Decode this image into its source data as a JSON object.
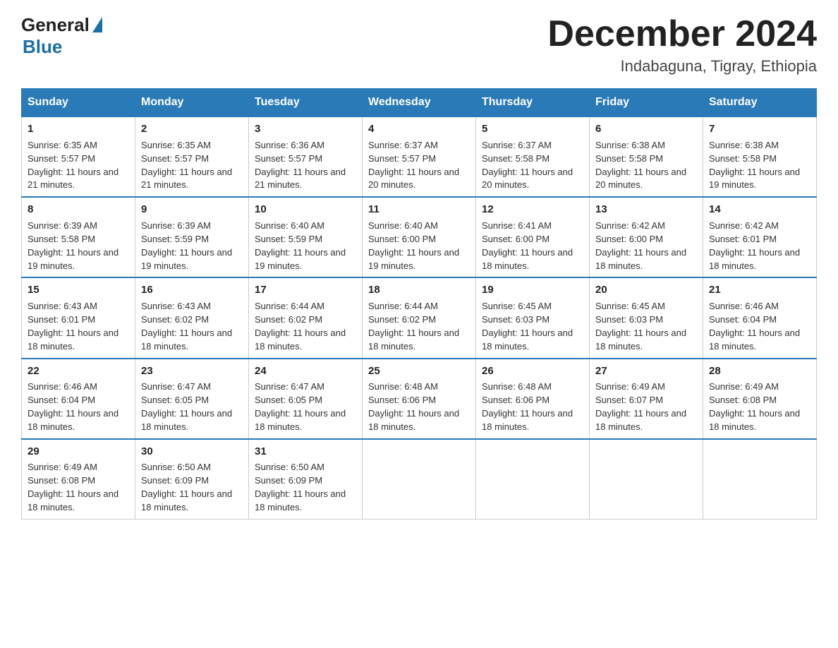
{
  "header": {
    "logo_general": "General",
    "logo_blue": "Blue",
    "month_title": "December 2024",
    "location": "Indabaguna, Tigray, Ethiopia"
  },
  "days_of_week": [
    "Sunday",
    "Monday",
    "Tuesday",
    "Wednesday",
    "Thursday",
    "Friday",
    "Saturday"
  ],
  "weeks": [
    [
      {
        "day": "1",
        "sunrise": "6:35 AM",
        "sunset": "5:57 PM",
        "daylight": "11 hours and 21 minutes."
      },
      {
        "day": "2",
        "sunrise": "6:35 AM",
        "sunset": "5:57 PM",
        "daylight": "11 hours and 21 minutes."
      },
      {
        "day": "3",
        "sunrise": "6:36 AM",
        "sunset": "5:57 PM",
        "daylight": "11 hours and 21 minutes."
      },
      {
        "day": "4",
        "sunrise": "6:37 AM",
        "sunset": "5:57 PM",
        "daylight": "11 hours and 20 minutes."
      },
      {
        "day": "5",
        "sunrise": "6:37 AM",
        "sunset": "5:58 PM",
        "daylight": "11 hours and 20 minutes."
      },
      {
        "day": "6",
        "sunrise": "6:38 AM",
        "sunset": "5:58 PM",
        "daylight": "11 hours and 20 minutes."
      },
      {
        "day": "7",
        "sunrise": "6:38 AM",
        "sunset": "5:58 PM",
        "daylight": "11 hours and 19 minutes."
      }
    ],
    [
      {
        "day": "8",
        "sunrise": "6:39 AM",
        "sunset": "5:58 PM",
        "daylight": "11 hours and 19 minutes."
      },
      {
        "day": "9",
        "sunrise": "6:39 AM",
        "sunset": "5:59 PM",
        "daylight": "11 hours and 19 minutes."
      },
      {
        "day": "10",
        "sunrise": "6:40 AM",
        "sunset": "5:59 PM",
        "daylight": "11 hours and 19 minutes."
      },
      {
        "day": "11",
        "sunrise": "6:40 AM",
        "sunset": "6:00 PM",
        "daylight": "11 hours and 19 minutes."
      },
      {
        "day": "12",
        "sunrise": "6:41 AM",
        "sunset": "6:00 PM",
        "daylight": "11 hours and 18 minutes."
      },
      {
        "day": "13",
        "sunrise": "6:42 AM",
        "sunset": "6:00 PM",
        "daylight": "11 hours and 18 minutes."
      },
      {
        "day": "14",
        "sunrise": "6:42 AM",
        "sunset": "6:01 PM",
        "daylight": "11 hours and 18 minutes."
      }
    ],
    [
      {
        "day": "15",
        "sunrise": "6:43 AM",
        "sunset": "6:01 PM",
        "daylight": "11 hours and 18 minutes."
      },
      {
        "day": "16",
        "sunrise": "6:43 AM",
        "sunset": "6:02 PM",
        "daylight": "11 hours and 18 minutes."
      },
      {
        "day": "17",
        "sunrise": "6:44 AM",
        "sunset": "6:02 PM",
        "daylight": "11 hours and 18 minutes."
      },
      {
        "day": "18",
        "sunrise": "6:44 AM",
        "sunset": "6:02 PM",
        "daylight": "11 hours and 18 minutes."
      },
      {
        "day": "19",
        "sunrise": "6:45 AM",
        "sunset": "6:03 PM",
        "daylight": "11 hours and 18 minutes."
      },
      {
        "day": "20",
        "sunrise": "6:45 AM",
        "sunset": "6:03 PM",
        "daylight": "11 hours and 18 minutes."
      },
      {
        "day": "21",
        "sunrise": "6:46 AM",
        "sunset": "6:04 PM",
        "daylight": "11 hours and 18 minutes."
      }
    ],
    [
      {
        "day": "22",
        "sunrise": "6:46 AM",
        "sunset": "6:04 PM",
        "daylight": "11 hours and 18 minutes."
      },
      {
        "day": "23",
        "sunrise": "6:47 AM",
        "sunset": "6:05 PM",
        "daylight": "11 hours and 18 minutes."
      },
      {
        "day": "24",
        "sunrise": "6:47 AM",
        "sunset": "6:05 PM",
        "daylight": "11 hours and 18 minutes."
      },
      {
        "day": "25",
        "sunrise": "6:48 AM",
        "sunset": "6:06 PM",
        "daylight": "11 hours and 18 minutes."
      },
      {
        "day": "26",
        "sunrise": "6:48 AM",
        "sunset": "6:06 PM",
        "daylight": "11 hours and 18 minutes."
      },
      {
        "day": "27",
        "sunrise": "6:49 AM",
        "sunset": "6:07 PM",
        "daylight": "11 hours and 18 minutes."
      },
      {
        "day": "28",
        "sunrise": "6:49 AM",
        "sunset": "6:08 PM",
        "daylight": "11 hours and 18 minutes."
      }
    ],
    [
      {
        "day": "29",
        "sunrise": "6:49 AM",
        "sunset": "6:08 PM",
        "daylight": "11 hours and 18 minutes."
      },
      {
        "day": "30",
        "sunrise": "6:50 AM",
        "sunset": "6:09 PM",
        "daylight": "11 hours and 18 minutes."
      },
      {
        "day": "31",
        "sunrise": "6:50 AM",
        "sunset": "6:09 PM",
        "daylight": "11 hours and 18 minutes."
      },
      null,
      null,
      null,
      null
    ]
  ],
  "labels": {
    "sunrise_prefix": "Sunrise: ",
    "sunset_prefix": "Sunset: ",
    "daylight_prefix": "Daylight: "
  }
}
